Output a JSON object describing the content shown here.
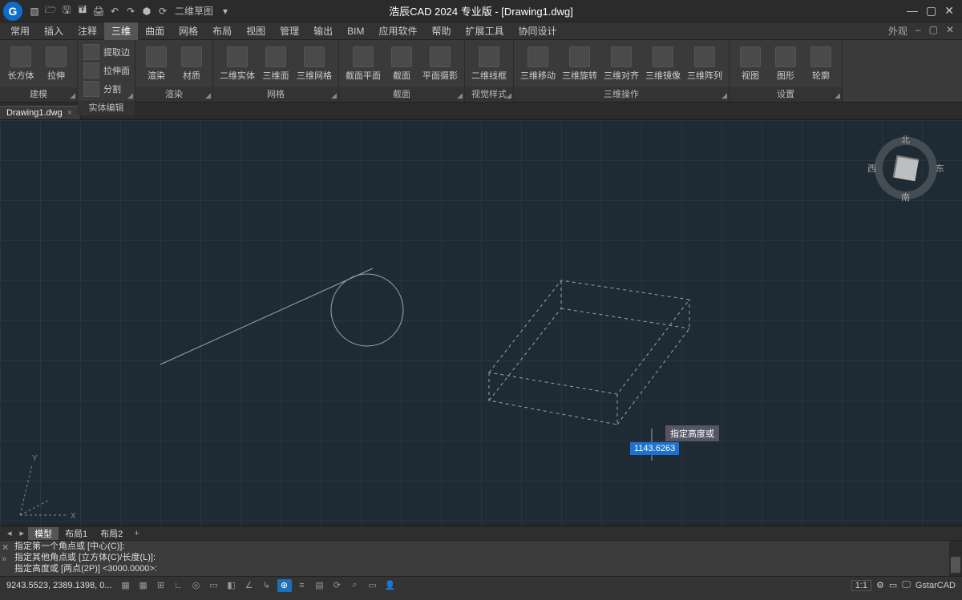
{
  "title": "浩辰CAD 2024 专业版 - [Drawing1.dwg]",
  "app_short": "G",
  "qat_workspace": "二维草图",
  "menubar": {
    "tabs": [
      "常用",
      "插入",
      "注释",
      "三维",
      "曲面",
      "网格",
      "布局",
      "视图",
      "管理",
      "输出",
      "BIM",
      "应用软件",
      "帮助",
      "扩展工具",
      "协同设计"
    ],
    "active": 3,
    "right_label": "外观"
  },
  "ribbon_groups": [
    {
      "label": "建模",
      "big": [
        {
          "t": "长方体"
        },
        {
          "t": "拉伸"
        }
      ]
    },
    {
      "label": "实体编辑",
      "items": [
        "提取边",
        "拉伸面",
        "分割"
      ]
    },
    {
      "label": "渲染",
      "big": [
        {
          "t": "渲染"
        },
        {
          "t": "材质"
        }
      ]
    },
    {
      "label": "网格",
      "big": [
        {
          "t": "二维实体"
        },
        {
          "t": "三维面"
        },
        {
          "t": "三维网格"
        }
      ]
    },
    {
      "label": "截面",
      "big": [
        {
          "t": "截面平面"
        },
        {
          "t": "截面"
        },
        {
          "t": "平面摄影"
        }
      ]
    },
    {
      "label": "视觉样式",
      "big": [
        {
          "t": "二维线框"
        }
      ]
    },
    {
      "label": "三维操作",
      "big": [
        {
          "t": "三维移动"
        },
        {
          "t": "三维旋转"
        },
        {
          "t": "三维对齐"
        },
        {
          "t": "三维镜像"
        },
        {
          "t": "三维阵列"
        }
      ]
    },
    {
      "label": "设置",
      "big": [
        {
          "t": "视图"
        },
        {
          "t": "图形"
        },
        {
          "t": "轮廓"
        }
      ]
    }
  ],
  "filetab": "Drawing1.dwg",
  "viewcube_dirs": {
    "n": "北",
    "s": "南",
    "e": "东",
    "w": "西"
  },
  "dynamic_prompt": "指定高度或",
  "dynamic_value": "1143.6263",
  "cmd_history": [
    "指定第一个角点或 [中心(C)]:",
    "指定其他角点或 [立方体(C)/长度(L)]:",
    "指定高度或 [两点(2P)] <3000.0000>:"
  ],
  "model_tabs": [
    "模型",
    "布局1",
    "布局2"
  ],
  "model_active": 0,
  "status": {
    "coords": "9243.5523, 2389.1398, 0...",
    "ratio": "1:1",
    "brand": "GstarCAD"
  }
}
